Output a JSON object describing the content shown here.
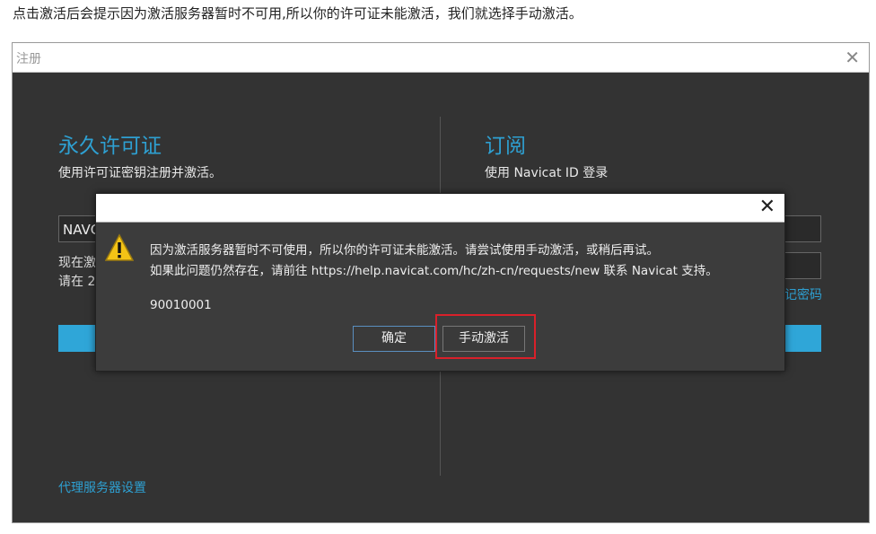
{
  "caption": "点击激活后会提示因为激活服务器暂时不可用,所以你的许可证未能激活，我们就选择手动激活。",
  "window": {
    "title": "注册",
    "close_icon": "close-icon"
  },
  "left": {
    "heading": "永久许可证",
    "subtitle": "使用许可证密钥注册并激活。",
    "key_input_value": "NAVC",
    "line1": "现在激",
    "line2": "请在 2",
    "proxy_link": "代理服务器设置"
  },
  "right": {
    "heading": "订阅",
    "subtitle": "使用 Navicat ID 登录",
    "forgot_link": "记密码"
  },
  "dialog": {
    "icon": "warning-icon",
    "message_line1": "因为激活服务器暂时不可使用，所以你的许可证未能激活。请尝试使用手动激活，或稍后再试。",
    "message_line2": "如果此问题仍然存在，请前往 https://help.navicat.com/hc/zh-cn/requests/new 联系 Navicat 支持。",
    "code": "90010001",
    "ok_label": "确定",
    "manual_label": "手动激活"
  },
  "colors": {
    "accent": "#2ea0d2",
    "highlight": "#d9202a"
  }
}
